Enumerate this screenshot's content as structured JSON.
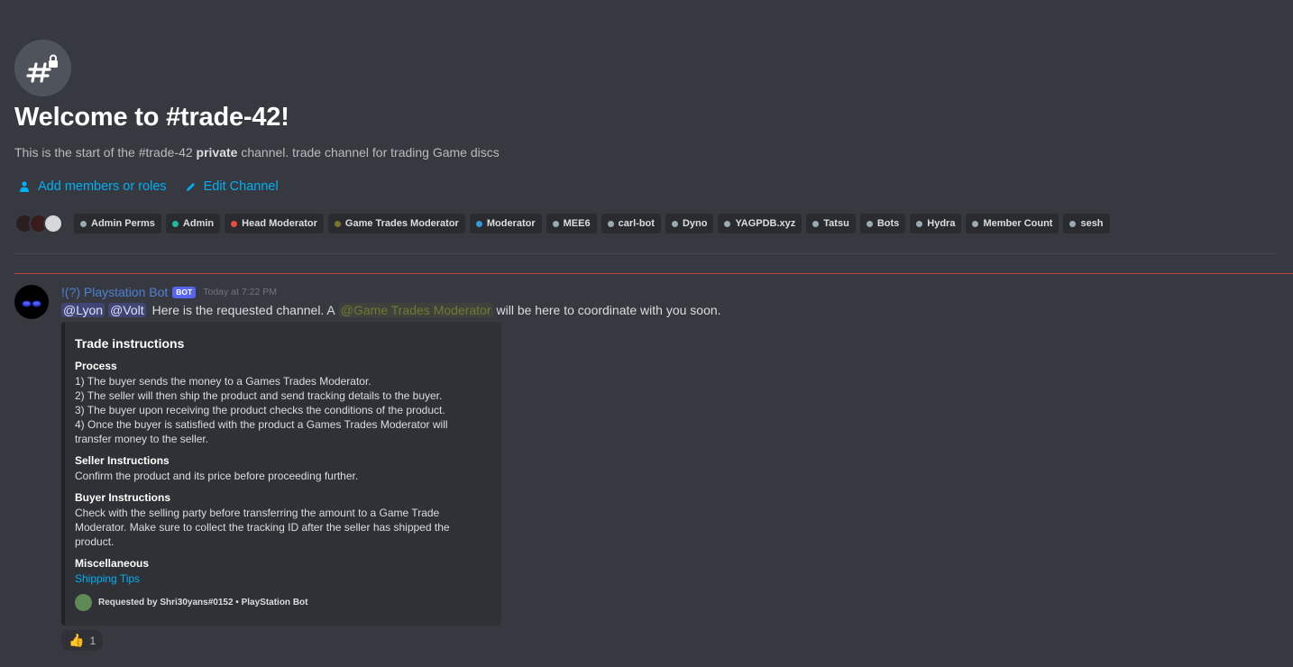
{
  "channel": {
    "icon": "hash-lock-icon",
    "welcome_title": "Welcome to #trade-42!",
    "subtitle_prefix": "This is the start of the #trade-42 ",
    "subtitle_bold": "private",
    "subtitle_suffix": " channel. trade channel for trading Game discs"
  },
  "actions": {
    "add_members": "Add members or roles",
    "edit_channel": "Edit Channel"
  },
  "roles": [
    {
      "name": "Admin Perms",
      "color": "#99aab5"
    },
    {
      "name": "Admin",
      "color": "#1abc9c"
    },
    {
      "name": "Head Moderator",
      "color": "#e74c3c"
    },
    {
      "name": "Game Trades Moderator",
      "color": "#79752b"
    },
    {
      "name": "Moderator",
      "color": "#3498db"
    },
    {
      "name": "MEE6",
      "color": "#99aab5"
    },
    {
      "name": "carl-bot",
      "color": "#99aab5"
    },
    {
      "name": "Dyno",
      "color": "#99aab5"
    },
    {
      "name": "YAGPDB.xyz",
      "color": "#99aab5"
    },
    {
      "name": "Tatsu",
      "color": "#99aab5"
    },
    {
      "name": "Bots",
      "color": "#99aab5"
    },
    {
      "name": "Hydra",
      "color": "#99aab5"
    },
    {
      "name": "Member Count",
      "color": "#99aab5"
    },
    {
      "name": "sesh",
      "color": "#99aab5"
    }
  ],
  "message": {
    "author": "!(?) Playstation Bot",
    "bot_tag": "BOT",
    "timestamp": "Today at 7:22 PM",
    "mention_1": "@Lyon",
    "mention_2": "@Volt",
    "text_before": "Here is the requested channel. A",
    "role_mention": "@Game Trades Moderator",
    "text_after": "will be here to coordinate with you soon."
  },
  "embed": {
    "title": "Trade instructions",
    "fields": [
      {
        "name": "Process",
        "lines": [
          "1) The buyer sends the money to a Games Trades Moderator.",
          "2) The seller will then ship the product and send tracking details to the buyer.",
          "3) The buyer upon receiving the product checks the conditions of the product.",
          "4) Once the buyer is satisfied with the product a Games Trades Moderator will",
          "transfer money to the seller."
        ]
      },
      {
        "name": "Seller Instructions",
        "lines": [
          "Confirm the product and its price before proceeding further."
        ]
      },
      {
        "name": "Buyer Instructions",
        "lines": [
          "Check with the selling party before transferring the amount to a Game Trade",
          "Moderator. Make sure to collect the tracking ID after the seller has shipped the",
          "product."
        ]
      },
      {
        "name": "Miscellaneous",
        "link": "Shipping Tips"
      }
    ],
    "footer": "Requested by Shri30yans#0152 • PlayStation Bot"
  },
  "reaction": {
    "emoji": "👍",
    "count": "1"
  }
}
